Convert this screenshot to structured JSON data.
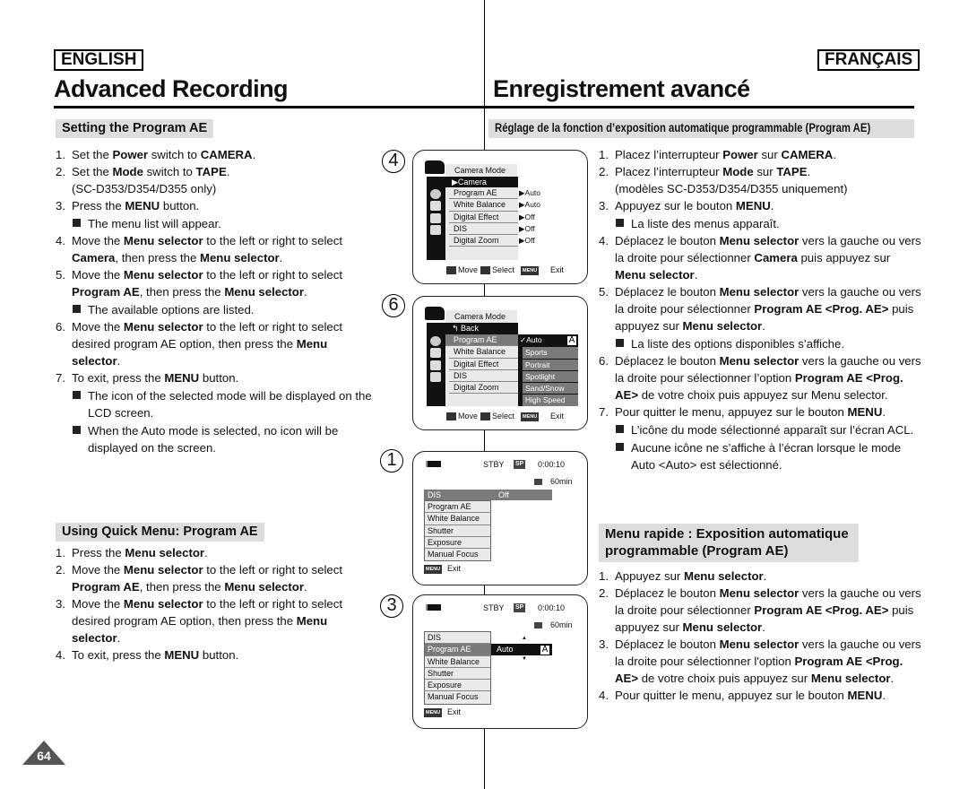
{
  "header": {
    "lang_en": "ENGLISH",
    "lang_fr": "FRANÇAIS",
    "title_en": "Advanced Recording",
    "title_fr": "Enregistrement avancé"
  },
  "en": {
    "section1": "Setting the Program AE",
    "steps1": [
      {
        "type": "step",
        "num": "1.",
        "segs": [
          [
            "Set the ",
            0
          ],
          [
            "Power",
            1
          ],
          [
            " switch to ",
            0
          ],
          [
            "CAMERA",
            1
          ],
          [
            ".",
            0
          ]
        ]
      },
      {
        "type": "step",
        "num": "2.",
        "segs": [
          [
            "Set the ",
            0
          ],
          [
            "Mode",
            1
          ],
          [
            " switch to ",
            0
          ],
          [
            "TAPE",
            1
          ],
          [
            ".\n(SC-D353/D354/D355 only)",
            0
          ]
        ]
      },
      {
        "type": "step",
        "num": "3.",
        "segs": [
          [
            "Press the ",
            0
          ],
          [
            "MENU",
            1
          ],
          [
            " button.",
            0
          ]
        ]
      },
      {
        "type": "bullet",
        "segs": [
          [
            "The menu list will appear.",
            0
          ]
        ]
      },
      {
        "type": "step",
        "num": "4.",
        "segs": [
          [
            "Move the ",
            0
          ],
          [
            "Menu selector",
            1
          ],
          [
            " to the left or right to select ",
            0
          ],
          [
            "Camera",
            1
          ],
          [
            ", then press the ",
            0
          ],
          [
            "Menu selector",
            1
          ],
          [
            ".",
            0
          ]
        ]
      },
      {
        "type": "step",
        "num": "5.",
        "segs": [
          [
            "Move the ",
            0
          ],
          [
            "Menu selector",
            1
          ],
          [
            " to the left or right to select ",
            0
          ],
          [
            "Program AE",
            1
          ],
          [
            ", then press the ",
            0
          ],
          [
            "Menu selector",
            1
          ],
          [
            ".",
            0
          ]
        ]
      },
      {
        "type": "bullet",
        "segs": [
          [
            "The available options are listed.",
            0
          ]
        ]
      },
      {
        "type": "step",
        "num": "6.",
        "segs": [
          [
            "Move the ",
            0
          ],
          [
            "Menu selector",
            1
          ],
          [
            " to the left or right to select desired program AE option, then press the ",
            0
          ],
          [
            "Menu selector",
            1
          ],
          [
            ".",
            0
          ]
        ]
      },
      {
        "type": "step",
        "num": "7.",
        "segs": [
          [
            "To exit, press the ",
            0
          ],
          [
            "MENU",
            1
          ],
          [
            " button.",
            0
          ]
        ]
      },
      {
        "type": "bullet",
        "segs": [
          [
            "The icon of the selected mode will be displayed on the LCD screen.",
            0
          ]
        ]
      },
      {
        "type": "bullet",
        "segs": [
          [
            "When the Auto mode is selected, no icon will be displayed on the screen.",
            0
          ]
        ]
      }
    ],
    "section2": "Using Quick Menu: Program AE",
    "steps2": [
      {
        "type": "step",
        "num": "1.",
        "segs": [
          [
            "Press the ",
            0
          ],
          [
            "Menu selector",
            1
          ],
          [
            ".",
            0
          ]
        ]
      },
      {
        "type": "step",
        "num": "2.",
        "segs": [
          [
            "Move the ",
            0
          ],
          [
            "Menu selector",
            1
          ],
          [
            " to the left or right to select ",
            0
          ],
          [
            "Program AE",
            1
          ],
          [
            ", then press the ",
            0
          ],
          [
            "Menu selector",
            1
          ],
          [
            ".",
            0
          ]
        ]
      },
      {
        "type": "step",
        "num": "3.",
        "segs": [
          [
            "Move the ",
            0
          ],
          [
            "Menu selector",
            1
          ],
          [
            " to the left or right to select desired program AE option, then press the ",
            0
          ],
          [
            "Menu selector",
            1
          ],
          [
            ".",
            0
          ]
        ]
      },
      {
        "type": "step",
        "num": "4.",
        "segs": [
          [
            "To exit, press the ",
            0
          ],
          [
            "MENU",
            1
          ],
          [
            " button.",
            0
          ]
        ]
      }
    ]
  },
  "fr": {
    "section1": "Réglage de la fonction d’exposition automatique programmable (Program AE)",
    "steps1": [
      {
        "type": "step",
        "num": "1.",
        "segs": [
          [
            "Placez l’interrupteur ",
            0
          ],
          [
            "Power",
            1
          ],
          [
            " sur ",
            0
          ],
          [
            "CAMERA",
            1
          ],
          [
            ".",
            0
          ]
        ]
      },
      {
        "type": "step",
        "num": "2.",
        "segs": [
          [
            "Placez l’interrupteur ",
            0
          ],
          [
            "Mode",
            1
          ],
          [
            " sur ",
            0
          ],
          [
            "TAPE",
            1
          ],
          [
            ".\n(modèles SC-D353/D354/D355 uniquement)",
            0
          ]
        ]
      },
      {
        "type": "step",
        "num": "3.",
        "segs": [
          [
            "Appuyez sur le bouton ",
            0
          ],
          [
            "MENU",
            1
          ],
          [
            ".",
            0
          ]
        ]
      },
      {
        "type": "bullet",
        "segs": [
          [
            "La liste des menus apparaît.",
            0
          ]
        ]
      },
      {
        "type": "step",
        "num": "4.",
        "segs": [
          [
            "Déplacez le bouton ",
            0
          ],
          [
            "Menu selector",
            1
          ],
          [
            " vers la gauche ou vers la droite pour sélectionner ",
            0
          ],
          [
            "Camera",
            1
          ],
          [
            " puis appuyez sur ",
            0
          ],
          [
            "Menu selector",
            1
          ],
          [
            ".",
            0
          ]
        ]
      },
      {
        "type": "step",
        "num": "5.",
        "segs": [
          [
            "Déplacez le bouton ",
            0
          ],
          [
            "Menu selector",
            1
          ],
          [
            " vers la gauche ou vers la droite pour sélectionner ",
            0
          ],
          [
            "Program AE <Prog. AE>",
            1
          ],
          [
            " puis appuyez sur ",
            0
          ],
          [
            "Menu selector",
            1
          ],
          [
            ".",
            0
          ]
        ]
      },
      {
        "type": "bullet",
        "segs": [
          [
            "La liste des options disponibles s’affiche.",
            0
          ]
        ]
      },
      {
        "type": "step",
        "num": "6.",
        "segs": [
          [
            "Déplacez le bouton ",
            0
          ],
          [
            "Menu selector",
            1
          ],
          [
            " vers la gauche ou vers la droite pour sélectionner l’option ",
            0
          ],
          [
            "Program AE <Prog. AE>",
            1
          ],
          [
            " de votre choix puis appuyez sur Menu selector.",
            0
          ]
        ]
      },
      {
        "type": "step",
        "num": "7.",
        "segs": [
          [
            "Pour quitter le menu, appuyez sur le bouton ",
            0
          ],
          [
            "MENU",
            1
          ],
          [
            ".",
            0
          ]
        ]
      },
      {
        "type": "bullet",
        "segs": [
          [
            "L’icône du mode sélectionné apparaît sur l’écran ACL.",
            0
          ]
        ]
      },
      {
        "type": "bullet",
        "segs": [
          [
            "Aucune icône ne s’affiche à l’écran lorsque le mode Auto <Auto> est sélectionné.",
            0
          ]
        ]
      }
    ],
    "section2": "Menu rapide : Exposition automatique programmable (Program AE)",
    "steps2": [
      {
        "type": "step",
        "num": "1.",
        "segs": [
          [
            "Appuyez sur ",
            0
          ],
          [
            "Menu selector",
            1
          ],
          [
            ".",
            0
          ]
        ]
      },
      {
        "type": "step",
        "num": "2.",
        "segs": [
          [
            "Déplacez le bouton ",
            0
          ],
          [
            "Menu selector",
            1
          ],
          [
            " vers la gauche ou vers la droite pour sélectionner ",
            0
          ],
          [
            "Program AE <Prog. AE>",
            1
          ],
          [
            " puis appuyez sur ",
            0
          ],
          [
            "Menu selector",
            1
          ],
          [
            ".",
            0
          ]
        ]
      },
      {
        "type": "step",
        "num": "3.",
        "segs": [
          [
            "Déplacez le bouton ",
            0
          ],
          [
            "Menu selector",
            1
          ],
          [
            " vers la gauche ou vers la droite pour sélectionner l'option ",
            0
          ],
          [
            "Program AE <Prog. AE>",
            1
          ],
          [
            " de votre choix puis appuyez sur ",
            0
          ],
          [
            "Menu selector",
            1
          ],
          [
            ".",
            0
          ]
        ]
      },
      {
        "type": "step",
        "num": "4.",
        "segs": [
          [
            "Pour quitter le menu, appuyez sur le bouton ",
            0
          ],
          [
            "MENU",
            1
          ],
          [
            ".",
            0
          ]
        ]
      }
    ]
  },
  "screens": {
    "s4": {
      "step": "4",
      "header": "Camera Mode",
      "band": "▶Camera",
      "items": [
        "Program AE",
        "White Balance",
        "Digital Effect",
        "DIS",
        "Digital Zoom"
      ],
      "values": [
        "▶Auto",
        "▶Auto",
        "▶Off",
        "▶Off",
        "▶Off"
      ],
      "move": "Move",
      "select": "Select",
      "menu": "MENU",
      "exit": "Exit"
    },
    "s6": {
      "step": "6",
      "header": "Camera Mode",
      "band": "↰ Back",
      "items": [
        "Program AE",
        "White Balance",
        "Digital Effect",
        "DIS",
        "Digital Zoom"
      ],
      "options": [
        "✓Auto",
        "Sports",
        "Portrait",
        "Spotlight",
        "Sand/Snow",
        "High Speed"
      ],
      "auto_icon": "A",
      "move": "Move",
      "select": "Select",
      "menu": "MENU",
      "exit": "Exit"
    },
    "s1": {
      "step": "1",
      "stby": "STBY",
      "sp": "SP",
      "time": "0:00:10",
      "remain": "60min",
      "top_item": "DIS",
      "top_value": "Off",
      "items": [
        "Program AE",
        "White Balance",
        "Shutter",
        "Exposure",
        "Manual Focus"
      ],
      "menu": "MENU",
      "exit": "Exit"
    },
    "s3": {
      "step": "3",
      "stby": "STBY",
      "sp": "SP",
      "time": "0:00:10",
      "remain": "60min",
      "items": [
        "DIS",
        "Program AE",
        "White Balance",
        "Shutter",
        "Exposure",
        "Manual Focus"
      ],
      "value": "Auto",
      "auto_icon": "A",
      "menu": "MENU",
      "exit": "Exit"
    }
  },
  "page_number": "64"
}
